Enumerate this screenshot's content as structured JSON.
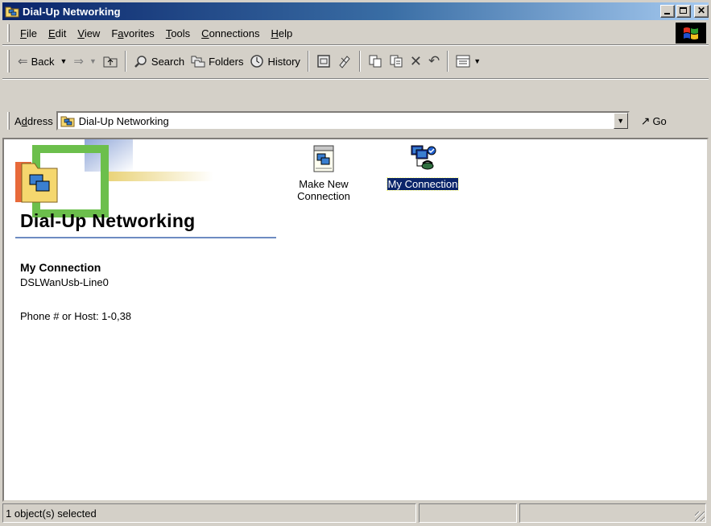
{
  "window": {
    "title": "Dial-Up Networking",
    "buttons": [
      "_",
      "□",
      "x"
    ]
  },
  "menu": [
    {
      "label": "File",
      "accel": "F",
      "rest": "ile"
    },
    {
      "label": "Edit",
      "accel": "E",
      "rest": "dit"
    },
    {
      "label": "View",
      "accel": "V",
      "rest": "iew"
    },
    {
      "label": "Favorites",
      "pre": "F",
      "accel": "a",
      "rest": "vorites"
    },
    {
      "label": "Tools",
      "accel": "T",
      "rest": "ools"
    },
    {
      "label": "Connections",
      "accel": "C",
      "rest": "onnections"
    },
    {
      "label": "Help",
      "accel": "H",
      "rest": "elp"
    }
  ],
  "toolbar": {
    "back_label": "Back",
    "search_label": "Search",
    "folders_label": "Folders",
    "history_label": "History"
  },
  "address": {
    "label_pre": "A",
    "label_accel": "d",
    "label_rest": "dress",
    "value": "Dial-Up Networking",
    "go_label": "Go"
  },
  "content": {
    "page_title": "Dial-Up Networking",
    "selected": {
      "name": "My Connection",
      "device": "DSLWanUsb-Line0",
      "phone": "Phone # or Host: 1-0,38"
    },
    "icons": [
      {
        "line1": "Make New",
        "line2": "Connection",
        "icon": "make-new-connection-icon"
      },
      {
        "line1": "My Connection",
        "icon": "my-connection-icon",
        "selected": true
      }
    ]
  },
  "status": {
    "text": "1 object(s) selected"
  },
  "colors": {
    "title_active": "#0a246a",
    "selection": "#0a246a",
    "face": "#d4d0c8"
  }
}
